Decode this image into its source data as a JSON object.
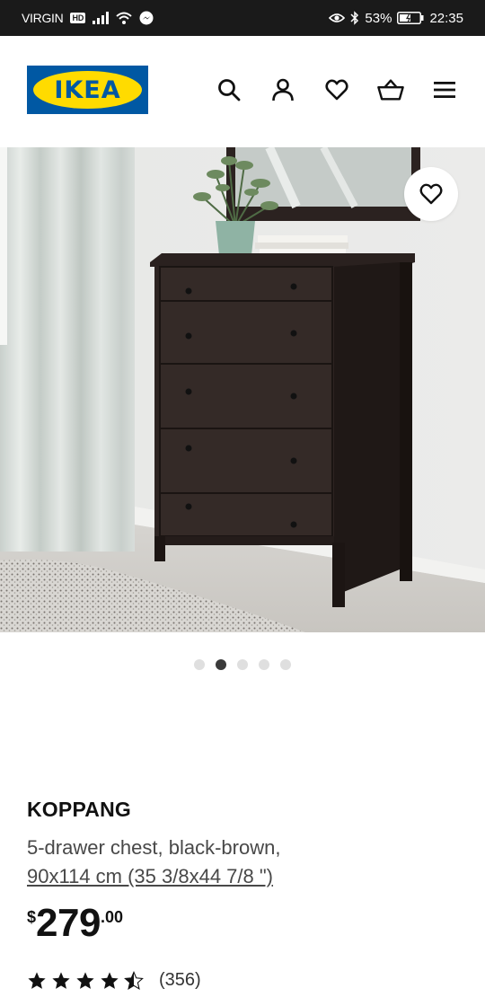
{
  "status_bar": {
    "carrier": "VIRGIN",
    "network_badge": "HD",
    "battery_percent": "53%",
    "time": "22:35"
  },
  "header": {
    "logo_text": "IKEA",
    "icons": [
      "search-icon",
      "account-icon",
      "wishlist-icon",
      "cart-icon",
      "menu-icon"
    ]
  },
  "carousel": {
    "total": 5,
    "active_index": 1
  },
  "product": {
    "name": "KOPPANG",
    "description": "5-drawer chest, black-brown,",
    "size": "90x114 cm (35 3/8x44 7/8 \")",
    "price_currency": "$",
    "price_int": "279",
    "price_decimal": ".00",
    "rating": 4.5,
    "rating_count": "(356)"
  },
  "colors": {
    "ikea_blue": "#0058a3",
    "ikea_yellow": "#ffdb00",
    "status_bar_bg": "#1a1a1a"
  }
}
